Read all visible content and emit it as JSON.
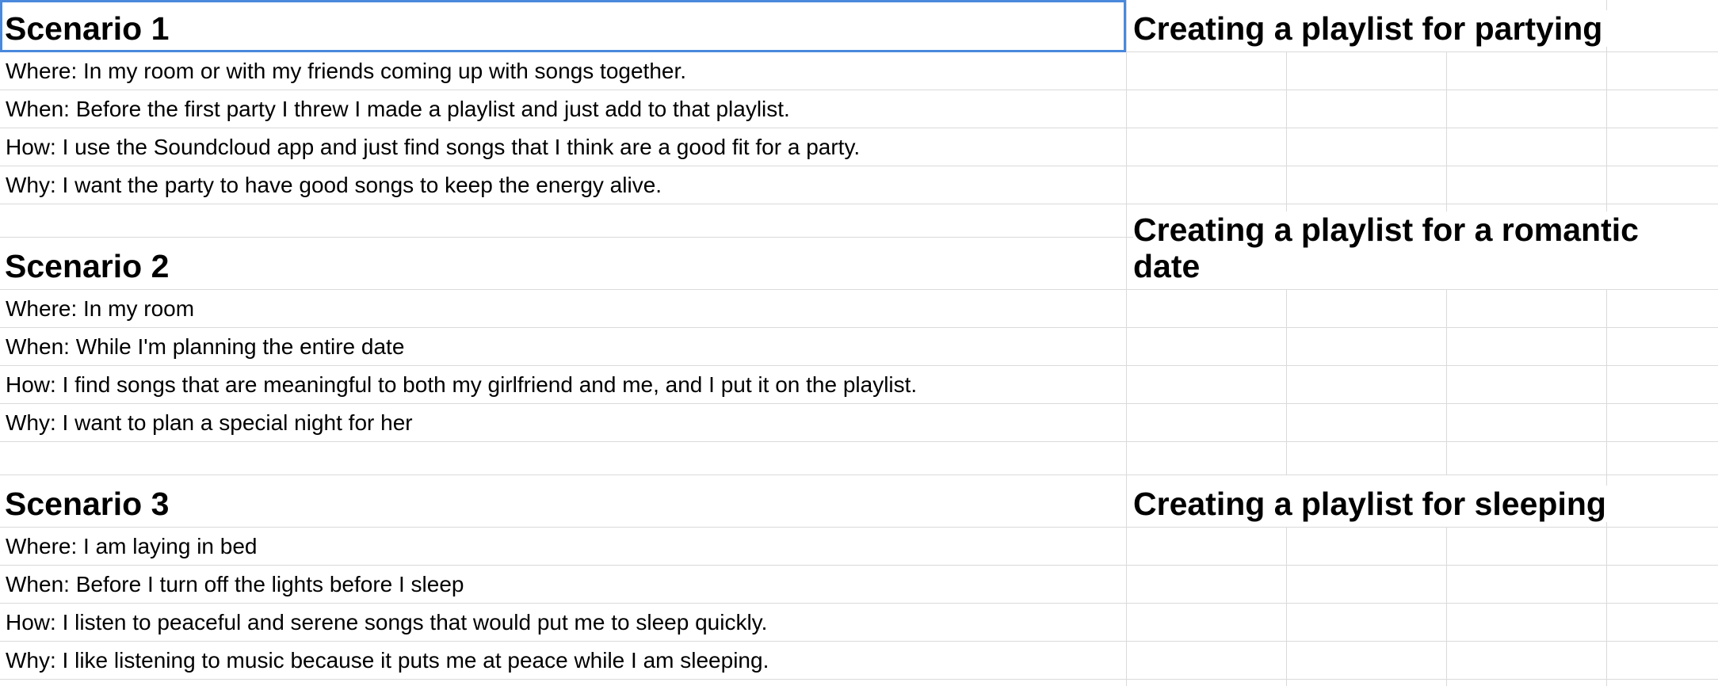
{
  "scenarios": [
    {
      "title": "Scenario 1",
      "subtitle": "Creating a playlist for partying",
      "where": "Where: In my room or with my friends coming up with songs together.",
      "when": "When: Before the first party I threw I made a playlist and just add to that playlist.",
      "how": "How: I use the Soundcloud app and just find songs that I think are a good fit for a party.",
      "why": "Why: I want the party to have good songs to keep the energy alive."
    },
    {
      "title": "Scenario 2",
      "subtitle": "Creating a playlist for a romantic date",
      "where": "Where: In my room",
      "when": "When: While I'm planning the entire date",
      "how": "How: I find songs that are meaningful to both my girlfriend and me, and I put it on the playlist.",
      "why": "Why: I want to plan a special night for her"
    },
    {
      "title": "Scenario 3",
      "subtitle": "Creating a playlist for sleeping",
      "where": "Where: I am laying in bed",
      "when": "When: Before I turn off the lights before I sleep",
      "how": "How: I listen to peaceful and serene songs that would put me to sleep quickly.",
      "why": "Why: I like listening to music because it puts me at peace while I am sleeping."
    }
  ],
  "colors": {
    "gridline": "#dadada",
    "selection": "#4a89dc"
  }
}
